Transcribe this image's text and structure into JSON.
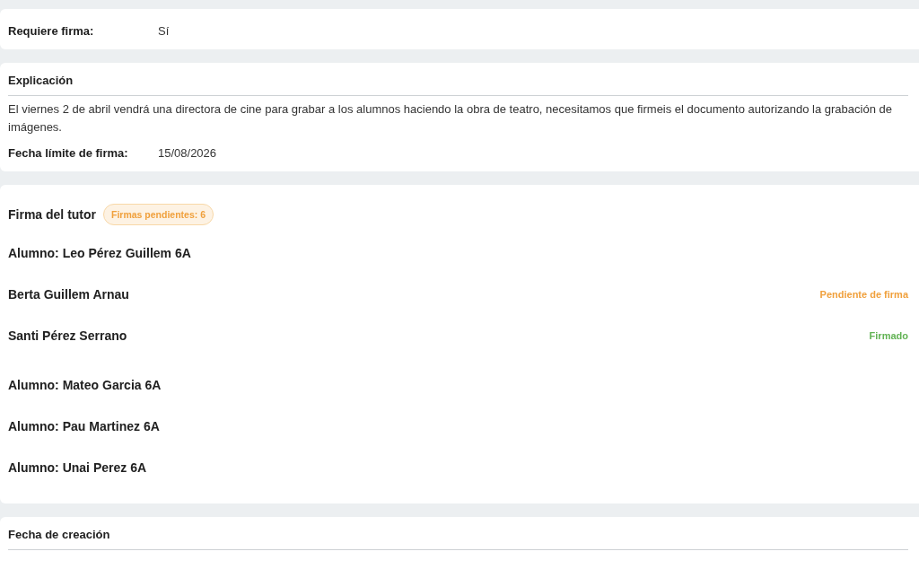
{
  "sections": [
    {
      "kind": "details",
      "rows": [
        {
          "label": "Requiere firma:",
          "value": "Sí"
        }
      ]
    },
    {
      "kind": "details",
      "title": "Explicación",
      "text": "El viernes 2 de abril vendrá una directora de cine para grabar a los alumnos haciendo la obra de teatro, necesitamos que firmeis el documento autorizando la grabación de imágenes.",
      "rows": [
        {
          "label": "Fecha límite de firma:",
          "value": "15/08/2026"
        }
      ]
    },
    {
      "kind": "signatures",
      "title": "Firma del tutor",
      "badge": "Firmas pendientes: 6",
      "students": [
        {
          "name": "Alumno: Leo Pérez Guillem 6A",
          "tutors": [
            {
              "name": "Berta Guillem Arnau",
              "status": "Pendiente de firma",
              "signed": false
            },
            {
              "name": "Santi Pérez Serrano",
              "status": "Firmado",
              "signed": true
            }
          ]
        },
        {
          "name": "Alumno: Mateo Garcia 6A"
        },
        {
          "name": "Alumno: Pau Martinez 6A"
        },
        {
          "name": "Alumno: Unai Perez 6A"
        }
      ]
    },
    {
      "kind": "details",
      "title": "Fecha de creación"
    }
  ]
}
